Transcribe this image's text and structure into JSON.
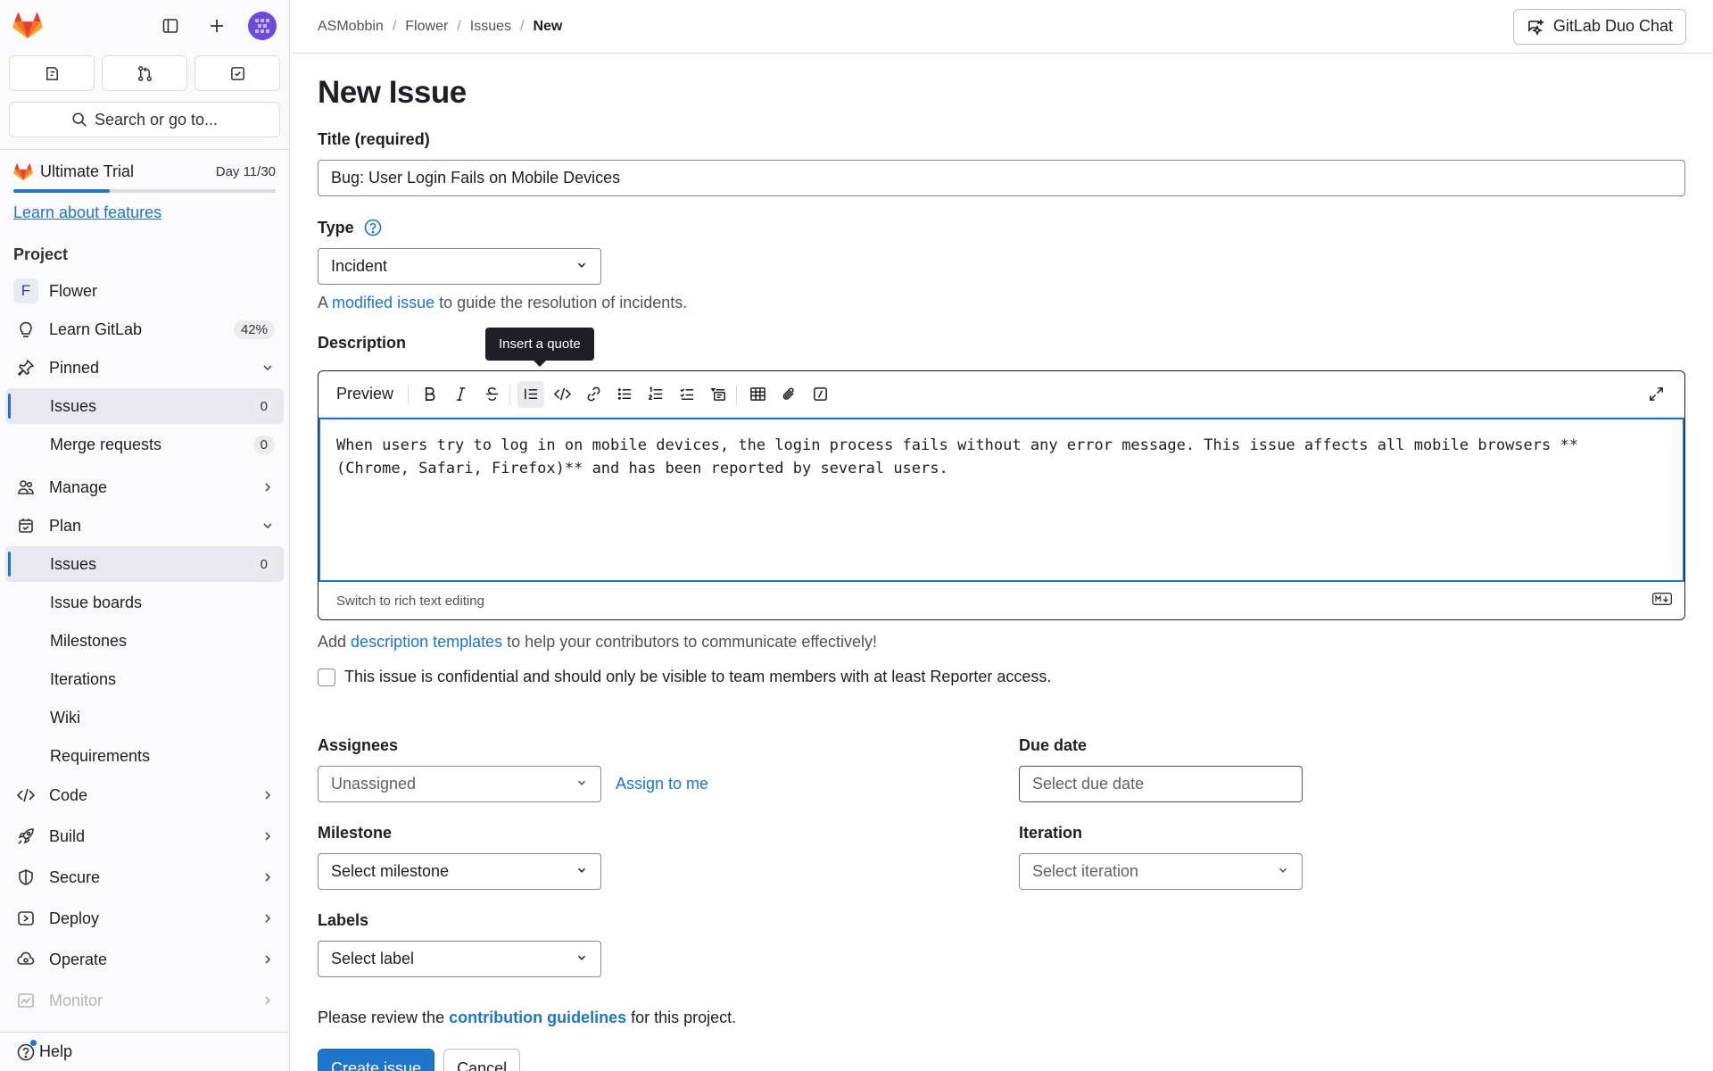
{
  "sidebar": {
    "search_label": "Search or go to...",
    "trial": {
      "name": "Ultimate Trial",
      "day": "Day 11/30",
      "progress": 0.367,
      "learn_link": "Learn about features"
    },
    "section_title": "Project",
    "items": [
      {
        "label": "Flower",
        "icon": "project-avatar",
        "avatar_letter": "F"
      },
      {
        "label": "Learn GitLab",
        "icon": "lightbulb-icon",
        "badge": "42%"
      },
      {
        "label": "Pinned",
        "icon": "pin-icon"
      },
      {
        "label": "Issues",
        "badge": "0"
      },
      {
        "label": "Merge requests",
        "badge": "0"
      },
      {
        "label": "Manage",
        "icon": "users-icon"
      },
      {
        "label": "Plan",
        "icon": "planning-icon"
      },
      {
        "label": "Issues",
        "badge": "0"
      },
      {
        "label": "Issue boards"
      },
      {
        "label": "Milestones"
      },
      {
        "label": "Iterations"
      },
      {
        "label": "Wiki"
      },
      {
        "label": "Requirements"
      },
      {
        "label": "Code",
        "icon": "code-icon"
      },
      {
        "label": "Build",
        "icon": "rocket-icon"
      },
      {
        "label": "Secure",
        "icon": "shield-icon"
      },
      {
        "label": "Deploy",
        "icon": "deploy-icon"
      },
      {
        "label": "Operate",
        "icon": "cloud-gear-icon"
      },
      {
        "label": "Monitor",
        "icon": "monitor-icon"
      }
    ],
    "help_label": "Help"
  },
  "header": {
    "breadcrumbs": [
      "ASMobbin",
      "Flower",
      "Issues",
      "New"
    ],
    "duo_button": "GitLab Duo Chat"
  },
  "form": {
    "page_title": "New Issue",
    "title_label": "Title (required)",
    "title_value": "Bug: User Login Fails on Mobile Devices",
    "type_label": "Type",
    "type_value": "Incident",
    "type_help_prefix": "A",
    "type_help_link": "modified issue",
    "type_help_suffix": "to guide the resolution of incidents.",
    "description_label": "Description",
    "tooltip": "Insert a quote",
    "preview_label": "Preview",
    "description_text": "When users try to log in on mobile devices, the login process fails without any error message. This issue affects all mobile browsers **\n(Chrome, Safari, Firefox)** and has been reported by several users.",
    "switch_rich_text": "Switch to rich text editing",
    "templates_prefix": "Add",
    "templates_link": "description templates",
    "templates_suffix": "to help your contributors to communicate effectively!",
    "confidential_label": "This issue is confidential and should only be visible to team members with at least Reporter access.",
    "assignees_label": "Assignees",
    "assignees_value": "Unassigned",
    "assign_to_me": "Assign to me",
    "due_date_label": "Due date",
    "due_date_placeholder": "Select due date",
    "milestone_label": "Milestone",
    "milestone_value": "Select milestone",
    "iteration_label": "Iteration",
    "iteration_value": "Select iteration",
    "labels_label": "Labels",
    "labels_value": "Select label",
    "guidelines_prefix": "Please review the",
    "guidelines_link": "contribution guidelines",
    "guidelines_suffix": "for this project.",
    "create_button": "Create issue",
    "cancel_button": "Cancel"
  },
  "colors": {
    "accent": "#1f75cb",
    "brand_orange": "#e24329",
    "text": "#1f1e24"
  }
}
